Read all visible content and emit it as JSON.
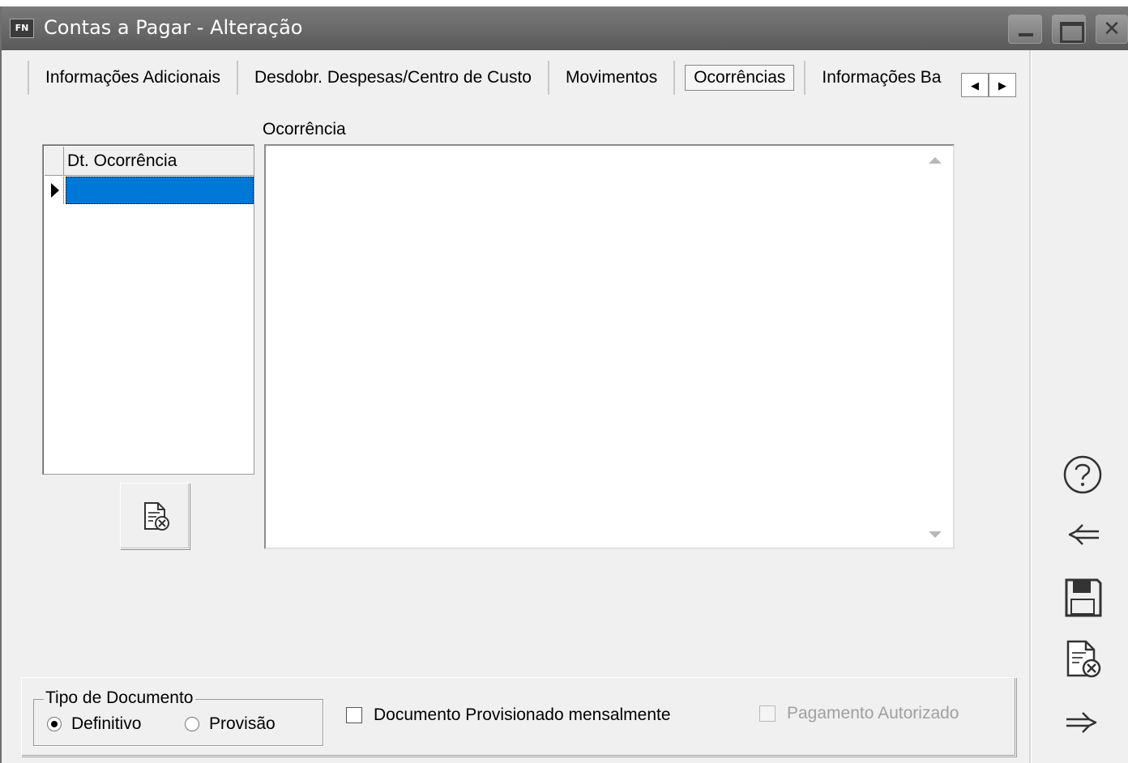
{
  "window": {
    "app_badge": "FN",
    "title": "Contas a Pagar - Alteração"
  },
  "tabs": [
    {
      "label": "Informações Adicionais",
      "active": false
    },
    {
      "label": "Desdobr. Despesas/Centro de Custo",
      "active": false
    },
    {
      "label": "Movimentos",
      "active": false
    },
    {
      "label": "Ocorrências",
      "active": true
    },
    {
      "label": "Informações Ba",
      "active": false
    }
  ],
  "grid": {
    "column_header": "Dt. Ocorrência",
    "rows": [
      ""
    ]
  },
  "memo": {
    "label": "Ocorrência",
    "value": ""
  },
  "document_type": {
    "legend": "Tipo de Documento",
    "options": [
      {
        "label": "Definitivo",
        "selected": true
      },
      {
        "label": "Provisão",
        "selected": false
      }
    ]
  },
  "checkboxes": {
    "provisioned_monthly": {
      "label": "Documento Provisionado mensalmente",
      "checked": false
    },
    "payment_authorized": {
      "label": "Pagamento Autorizado",
      "checked": false,
      "enabled": false
    }
  },
  "side_toolbar": [
    "help-icon",
    "back-arrow-icon",
    "save-disk-icon",
    "delete-document-icon",
    "forward-arrow-icon"
  ],
  "colors": {
    "selection": "#0078d7",
    "titlebar": "#6a6a6a"
  }
}
